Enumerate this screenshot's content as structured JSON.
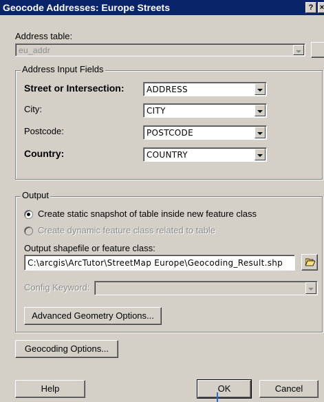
{
  "window": {
    "title": "Geocode Addresses:  Europe Streets",
    "help_glyph": "?",
    "close_glyph": "×"
  },
  "address_table": {
    "label": "Address table:",
    "value": "eu_addr"
  },
  "input_fields": {
    "group_label": "Address Input Fields",
    "rows": [
      {
        "label": "Street or Intersection:",
        "value": "ADDRESS"
      },
      {
        "label": "City:",
        "value": "CITY"
      },
      {
        "label": "Postcode:",
        "value": "POSTCODE"
      },
      {
        "label": "Country:",
        "value": "COUNTRY"
      }
    ]
  },
  "output": {
    "group_label": "Output",
    "radio_static": "Create static snapshot of table inside new feature class",
    "radio_dynamic": "Create dynamic feature class related to table",
    "shapefile_label": "Output shapefile or feature class:",
    "shapefile_value": "C:\\arcgis\\ArcTutor\\StreetMap Europe\\Geocoding_Result.shp",
    "config_label": "Config Keyword:",
    "config_value": "",
    "advanced_button": "Advanced Geometry Options..."
  },
  "buttons": {
    "geocoding_options": "Geocoding Options...",
    "help": "Help",
    "ok": "OK",
    "cancel": "Cancel"
  },
  "colors": {
    "titlebar": "#0a246a",
    "dialog_bg": "#d4d0c8"
  }
}
